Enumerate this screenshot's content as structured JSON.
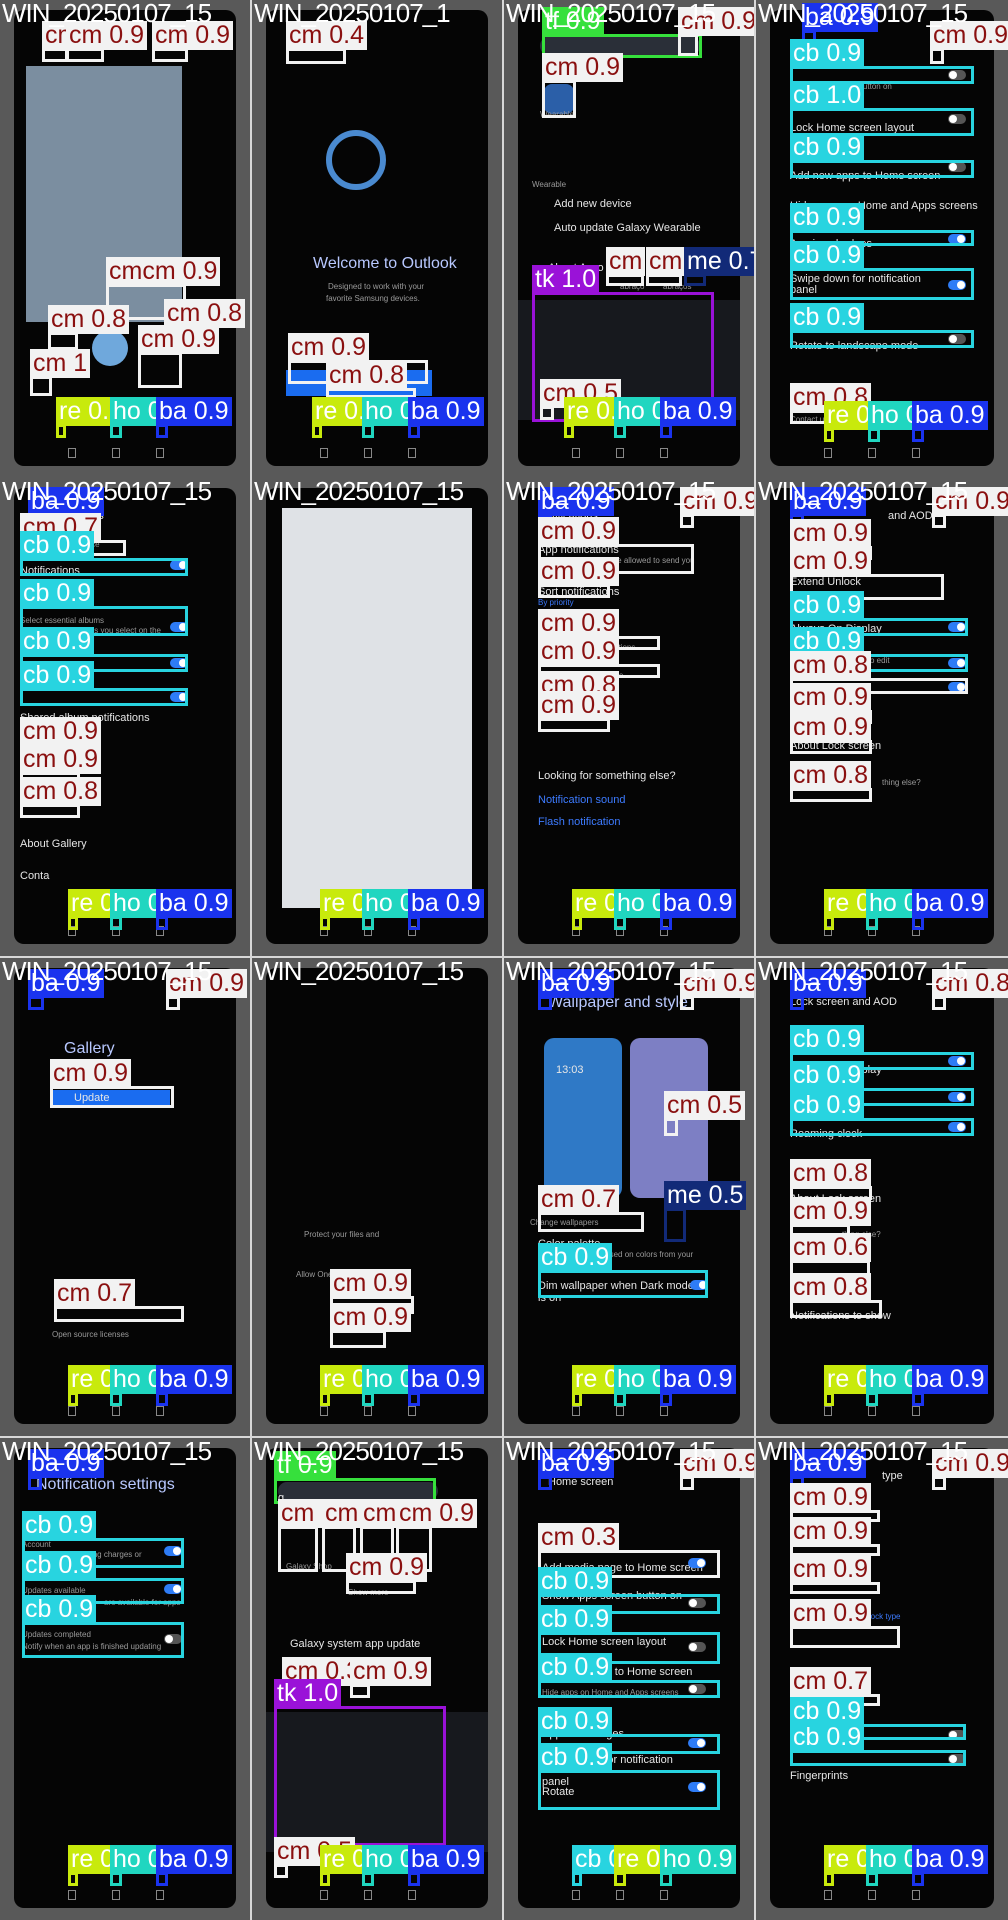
{
  "palette": {
    "re": "#c8ea0c",
    "cb": "#28d4e0",
    "ba": "#1a33ee",
    "cm": "#f2f2f2",
    "tf": "#36e03c",
    "tk": "#9a12d8",
    "me": "#122a78",
    "ho": "#20d6c0"
  },
  "tiles": [
    {
      "file": "WIN_20250107_15",
      "texts": []
    },
    {
      "file": "WIN_20250107_1",
      "texts": [
        {
          "k": "welcome_title",
          "v": "Welcome to Outlook"
        },
        {
          "k": "welcome_sub1",
          "v": "Designed to work with your"
        },
        {
          "k": "welcome_sub2",
          "v": "favorite Samsung devices."
        }
      ]
    },
    {
      "file": "WIN_20250107_15",
      "texts": [
        {
          "k": "search_text",
          "v": "ab"
        },
        {
          "k": "app_name",
          "v": "Wearable"
        },
        {
          "k": "section",
          "v": "Wearable"
        },
        {
          "k": "item1",
          "v": "Add new device"
        },
        {
          "k": "item2",
          "v": "Auto update Galaxy Wearable"
        },
        {
          "k": "item3",
          "v": "About Acco"
        },
        {
          "k": "sugg1",
          "v": "abraço"
        },
        {
          "k": "sugg2",
          "v": "abraços"
        }
      ]
    },
    {
      "file": "WIN_20250107_15",
      "texts": [
        {
          "k": "r1",
          "v": "Show Apps screen button on"
        },
        {
          "k": "r2",
          "v": "Lock Home screen layout"
        },
        {
          "k": "r3",
          "v": "Add new apps to Home screen"
        },
        {
          "k": "section",
          "v": "Hide apps on Home and Apps screens"
        },
        {
          "k": "r4",
          "v": "App icon badges"
        },
        {
          "k": "r5",
          "v": "Swipe down for notification"
        },
        {
          "k": "r5b",
          "v": "panel"
        },
        {
          "k": "r6",
          "v": "Rotate to landscape mode"
        },
        {
          "k": "r7",
          "v": "Contact us"
        }
      ]
    },
    {
      "file": "WIN_20250107_15",
      "texts": [
        {
          "k": "title",
          "v": "ngs"
        },
        {
          "k": "r0",
          "v": "Customization Service"
        },
        {
          "k": "r1",
          "v": "Notifications"
        },
        {
          "k": "r2",
          "v": "Select essential albums"
        },
        {
          "k": "r2s",
          "v": "Show only the albums you select on the"
        },
        {
          "k": "r3",
          "v": "Merge albums"
        },
        {
          "k": "r4",
          "v": "Shared album notifications"
        },
        {
          "k": "r5",
          "v": "Permissions"
        },
        {
          "k": "r6",
          "v": "About Gallery"
        },
        {
          "k": "r7",
          "v": "Conta"
        }
      ]
    },
    {
      "file": "WIN_20250107_15",
      "texts": []
    },
    {
      "file": "WIN_20250107_15",
      "texts": [
        {
          "k": "title",
          "v": "Notifications"
        },
        {
          "k": "r1",
          "v": "App notifications"
        },
        {
          "k": "r1s",
          "v": "Choose which apps are allowed to send you"
        },
        {
          "k": "r2",
          "v": "Sort notifications"
        },
        {
          "k": "r2s",
          "v": "By priority"
        },
        {
          "k": "r3",
          "v": "ations"
        },
        {
          "k": "r4",
          "v": "Notification pop-up style"
        },
        {
          "k": "r5",
          "v": "Advanced settings"
        },
        {
          "k": "r6",
          "v": "Looking for something else?"
        },
        {
          "k": "r7",
          "v": "Notification sound"
        },
        {
          "k": "r8",
          "v": "Flash notification"
        }
      ]
    },
    {
      "file": "WIN_20250107_15",
      "texts": [
        {
          "k": "title",
          "v": "and AOD"
        },
        {
          "k": "r1",
          "v": "Screen lock type"
        },
        {
          "k": "r2",
          "v": "Extend Unlock"
        },
        {
          "k": "r3",
          "v": "Always On Display"
        },
        {
          "k": "r4",
          "v": "o edit"
        },
        {
          "k": "r5",
          "v": "Widgets"
        },
        {
          "k": "r6",
          "v": "About Lock screen"
        },
        {
          "k": "r7",
          "v": "thing else?"
        }
      ]
    },
    {
      "file": "WIN_20250107_15",
      "texts": [
        {
          "k": "title",
          "v": "Gallery"
        },
        {
          "k": "btn",
          "v": "Update"
        },
        {
          "k": "r1",
          "v": "Open source licenses"
        }
      ]
    },
    {
      "file": "WIN_20250107_15",
      "texts": [
        {
          "k": "r1",
          "v": "Protect your files and"
        },
        {
          "k": "r2",
          "v": "Allow OneDrive"
        },
        {
          "k": "r3",
          "v": "Don't allow"
        }
      ]
    },
    {
      "file": "WIN_20250107_15",
      "texts": [
        {
          "k": "title",
          "v": "Wallpaper and style"
        },
        {
          "k": "time",
          "v": "13:03"
        },
        {
          "k": "r1",
          "v": "Change wallpapers"
        },
        {
          "k": "r2",
          "v": "Color palette"
        },
        {
          "k": "r2s",
          "v": "Choose a palette based on colors from your"
        },
        {
          "k": "r3",
          "v": "Dim wallpaper when Dark mode"
        },
        {
          "k": "r3b",
          "v": "is on"
        }
      ]
    },
    {
      "file": "WIN_20250107_15",
      "texts": [
        {
          "k": "title",
          "v": "Lock screen and AOD"
        },
        {
          "k": "r1",
          "v": "Always On Display"
        },
        {
          "k": "r2",
          "v": "o edit"
        },
        {
          "k": "r3",
          "v": "Roaming clock"
        },
        {
          "k": "r4",
          "v": "Widgets"
        },
        {
          "k": "r5",
          "v": "About Lock screen"
        },
        {
          "k": "r6",
          "v": "thing else?"
        },
        {
          "k": "r7",
          "v": "Fingerprints"
        },
        {
          "k": "r8",
          "v": "Notifications to show"
        }
      ]
    },
    {
      "file": "WIN_20250107_15",
      "texts": [
        {
          "k": "title",
          "v": "Notification settings"
        },
        {
          "k": "r1",
          "v": "Account"
        },
        {
          "k": "r1s",
          "v": "Notify about upcoming charges or"
        },
        {
          "k": "r2",
          "v": "Updates available"
        },
        {
          "k": "r2s",
          "v": "are available for apps"
        },
        {
          "k": "r3",
          "v": "Updates completed"
        },
        {
          "k": "r3s",
          "v": "Notify when an app is finished updating"
        }
      ]
    },
    {
      "file": "WIN_20250107_15",
      "texts": [
        {
          "k": "search_text",
          "v": "g"
        },
        {
          "k": "app1",
          "v": "Galaxy Shop"
        },
        {
          "k": "more",
          "v": "Show more"
        },
        {
          "k": "s1",
          "v": "Galaxy system app update"
        },
        {
          "k": "s2",
          "v": "Galaxy Wearable"
        }
      ]
    },
    {
      "file": "WIN_20250107_15",
      "texts": [
        {
          "k": "title",
          "v": "Home screen"
        },
        {
          "k": "r1",
          "v": "Add media page to Home screen"
        },
        {
          "k": "r2",
          "v": "Show Apps screen button on"
        },
        {
          "k": "r3",
          "v": "Lock Home screen layout"
        },
        {
          "k": "r4",
          "v": "Add new apps to Home screen"
        },
        {
          "k": "section",
          "v": "Hide apps on Home and Apps screens"
        },
        {
          "k": "r5",
          "v": "App icon badges"
        },
        {
          "k": "r6",
          "v": "Swipe down for notification"
        },
        {
          "k": "r6b",
          "v": "panel"
        },
        {
          "k": "r7",
          "v": "Rotate"
        }
      ]
    },
    {
      "file": "WIN_20250107_15",
      "texts": [
        {
          "k": "title",
          "v": "type"
        },
        {
          "k": "r1",
          "v": "PIN"
        },
        {
          "k": "r2",
          "v": "Password"
        },
        {
          "k": "r3",
          "v": "Pattern"
        },
        {
          "k": "r4",
          "v": "Swipe"
        },
        {
          "k": "r4s",
          "v": "No security."
        },
        {
          "k": "r4l",
          "v": "Current lock type"
        },
        {
          "k": "r5",
          "v": "Fingerprints"
        }
      ]
    }
  ],
  "detections": [
    [
      {
        "c": "cm",
        "s": "cm 0.9"
      },
      {
        "c": "cm",
        "s": "cm 0.9"
      },
      {
        "c": "cm",
        "s": "cm 0.9"
      },
      {
        "c": "cm",
        "s": "cmcm 0.9"
      },
      {
        "c": "cm",
        "s": "cm 0.8"
      },
      {
        "c": "cm",
        "s": "cm 0.8"
      },
      {
        "c": "cm",
        "s": "cm 1"
      },
      {
        "c": "cm",
        "s": "cm 0.9"
      },
      {
        "c": "re",
        "s": "re 0.9"
      },
      {
        "c": "ho",
        "s": "ho 0.9"
      },
      {
        "c": "ba",
        "s": "ba 0.9"
      }
    ],
    [
      {
        "c": "cm",
        "s": "cm 0.4"
      },
      {
        "c": "cm",
        "s": "cm 0.9"
      },
      {
        "c": "cm",
        "s": "cm 0.8"
      },
      {
        "c": "re",
        "s": "re 0.9"
      },
      {
        "c": "ho",
        "s": "ho 0.9"
      },
      {
        "c": "ba",
        "s": "ba 0.9"
      }
    ],
    [
      {
        "c": "tf",
        "s": "tf 0.9"
      },
      {
        "c": "cm",
        "s": "cm 0.9"
      },
      {
        "c": "cm",
        "s": "cm 0.9"
      },
      {
        "c": "cm",
        "s": "cm"
      },
      {
        "c": "cm",
        "s": "cm"
      },
      {
        "c": "me",
        "s": "me 0.7"
      },
      {
        "c": "tk",
        "s": "tk 1.0"
      },
      {
        "c": "cm",
        "s": "cm 0.5"
      },
      {
        "c": "re",
        "s": "re 0.9"
      },
      {
        "c": "ho",
        "s": "ho 0.9"
      },
      {
        "c": "ba",
        "s": "ba 0.9"
      }
    ],
    [
      {
        "c": "ba",
        "s": "ba 0.9"
      },
      {
        "c": "cm",
        "s": "cm 0.9"
      },
      {
        "c": "cb",
        "s": "cb 0.9"
      },
      {
        "c": "cb",
        "s": "cb 1.0"
      },
      {
        "c": "cb",
        "s": "cb 0.9"
      },
      {
        "c": "cb",
        "s": "cb 0.9"
      },
      {
        "c": "cb",
        "s": "cb 0.9"
      },
      {
        "c": "cb",
        "s": "cb 0.9"
      },
      {
        "c": "cm",
        "s": "cm 0.8"
      },
      {
        "c": "re",
        "s": "re 0.9"
      },
      {
        "c": "ho",
        "s": "ho 0.9"
      },
      {
        "c": "ba",
        "s": "ba 0.9"
      }
    ],
    [
      {
        "c": "ba",
        "s": "ba 0.9"
      },
      {
        "c": "cm",
        "s": "cm 0.7"
      },
      {
        "c": "cb",
        "s": "cb 0.9"
      },
      {
        "c": "cb",
        "s": "cb 0.9"
      },
      {
        "c": "cb",
        "s": "cb 0.9"
      },
      {
        "c": "cb",
        "s": "cb 0.9"
      },
      {
        "c": "cm",
        "s": "cm 0.9"
      },
      {
        "c": "cm",
        "s": "cm 0.9"
      },
      {
        "c": "cm",
        "s": "cm 0.8"
      },
      {
        "c": "re",
        "s": "re 0.9"
      },
      {
        "c": "ho",
        "s": "ho 0.9"
      },
      {
        "c": "ba",
        "s": "ba 0.9"
      }
    ],
    [
      {
        "c": "re",
        "s": "re 0.8"
      },
      {
        "c": "ho",
        "s": "ho 0.9"
      },
      {
        "c": "ba",
        "s": "ba 0.9"
      }
    ],
    [
      {
        "c": "ba",
        "s": "ba 0.9"
      },
      {
        "c": "cm",
        "s": "cm 0.9"
      },
      {
        "c": "cm",
        "s": "cm 0.9"
      },
      {
        "c": "cm",
        "s": "cm 0.9"
      },
      {
        "c": "cm",
        "s": "cm 0.9"
      },
      {
        "c": "cm",
        "s": "cm 0.9"
      },
      {
        "c": "cm",
        "s": "cm 0.8"
      },
      {
        "c": "cm",
        "s": "cm 0.9"
      },
      {
        "c": "re",
        "s": "re 0.9"
      },
      {
        "c": "ho",
        "s": "ho 0.9"
      },
      {
        "c": "ba",
        "s": "ba 0.9"
      }
    ],
    [
      {
        "c": "ba",
        "s": "ba 0.9"
      },
      {
        "c": "cm",
        "s": "cm 0.9"
      },
      {
        "c": "cm",
        "s": "cm 0.9"
      },
      {
        "c": "cm",
        "s": "cm 0.9"
      },
      {
        "c": "cb",
        "s": "cb 0.9"
      },
      {
        "c": "cb",
        "s": "cb 0.9"
      },
      {
        "c": "cm",
        "s": "cm 0.8"
      },
      {
        "c": "cm",
        "s": "cm 0.9"
      },
      {
        "c": "cm",
        "s": "cm 0.9"
      },
      {
        "c": "cm",
        "s": "cm 0.8"
      },
      {
        "c": "re",
        "s": "re 0.9"
      },
      {
        "c": "ho",
        "s": "ho 0.9"
      },
      {
        "c": "ba",
        "s": "ba 0.9"
      }
    ],
    [
      {
        "c": "ba",
        "s": "ba 0.9"
      },
      {
        "c": "cm",
        "s": "cm 0.9"
      },
      {
        "c": "cm",
        "s": "cm 0.9"
      },
      {
        "c": "cm",
        "s": "cm 0.7"
      },
      {
        "c": "re",
        "s": "re 0.9"
      },
      {
        "c": "ho",
        "s": "ho 0.9"
      },
      {
        "c": "ba",
        "s": "ba 0.9"
      }
    ],
    [
      {
        "c": "cm",
        "s": "cm 0.9"
      },
      {
        "c": "cm",
        "s": "cm 0.9"
      },
      {
        "c": "re",
        "s": "re 0.9"
      },
      {
        "c": "ho",
        "s": "ho 0.9"
      },
      {
        "c": "ba",
        "s": "ba 0.9"
      }
    ],
    [
      {
        "c": "ba",
        "s": "ba 0.9"
      },
      {
        "c": "cm",
        "s": "cm 0.9"
      },
      {
        "c": "cm",
        "s": "cm 0.5"
      },
      {
        "c": "cm",
        "s": "cm 0.7"
      },
      {
        "c": "me",
        "s": "me 0.5"
      },
      {
        "c": "cb",
        "s": "cb 0.9"
      },
      {
        "c": "re",
        "s": "re 0.9"
      },
      {
        "c": "ho",
        "s": "ho 0.9"
      },
      {
        "c": "ba",
        "s": "ba 0.9"
      }
    ],
    [
      {
        "c": "ba",
        "s": "ba 0.9"
      },
      {
        "c": "cm",
        "s": "cm 0.8"
      },
      {
        "c": "cb",
        "s": "cb 0.9"
      },
      {
        "c": "cb",
        "s": "cb 0.9"
      },
      {
        "c": "cb",
        "s": "cb 0.9"
      },
      {
        "c": "cm",
        "s": "cm 0.8"
      },
      {
        "c": "cm",
        "s": "cm 0.9"
      },
      {
        "c": "cm",
        "s": "cm 0.6"
      },
      {
        "c": "cm",
        "s": "cm 0.8"
      },
      {
        "c": "re",
        "s": "re 0.9"
      },
      {
        "c": "ho",
        "s": "ho 0.9"
      },
      {
        "c": "ba",
        "s": "ba 0.9"
      }
    ],
    [
      {
        "c": "ba",
        "s": "ba 0.9"
      },
      {
        "c": "cb",
        "s": "cb 0.9"
      },
      {
        "c": "cb",
        "s": "cb 0.9"
      },
      {
        "c": "cb",
        "s": "cb 0.9"
      },
      {
        "c": "re",
        "s": "re 0.9"
      },
      {
        "c": "ho",
        "s": "ho 0.9"
      },
      {
        "c": "ba",
        "s": "ba 0.9"
      }
    ],
    [
      {
        "c": "tf",
        "s": "tf 0.9"
      },
      {
        "c": "cm",
        "s": "cm 0.9"
      },
      {
        "c": "cm",
        "s": "cm 0.9"
      },
      {
        "c": "cm",
        "s": "cm 0.9"
      },
      {
        "c": "cm",
        "s": "cm 0.9"
      },
      {
        "c": "cm",
        "s": "cm 0.9"
      },
      {
        "c": "cm",
        "s": "cm 0.3"
      },
      {
        "c": "cm",
        "s": "cm 0.9"
      },
      {
        "c": "tk",
        "s": "tk 1.0"
      },
      {
        "c": "cm",
        "s": "cm 0.5"
      },
      {
        "c": "re",
        "s": "re 0.9"
      },
      {
        "c": "ho",
        "s": "ho 0.9"
      },
      {
        "c": "ba",
        "s": "ba 0.9"
      }
    ],
    [
      {
        "c": "ba",
        "s": "ba 0.9"
      },
      {
        "c": "cm",
        "s": "cm 0.9"
      },
      {
        "c": "cm",
        "s": "cm 0.3"
      },
      {
        "c": "cb",
        "s": "cb 0.9"
      },
      {
        "c": "cb",
        "s": "cb 0.9"
      },
      {
        "c": "cb",
        "s": "cb 0.9"
      },
      {
        "c": "cb",
        "s": "cb 0.9"
      },
      {
        "c": "cb",
        "s": "cb 0.9"
      },
      {
        "c": "cb",
        "s": "cb 0.9"
      },
      {
        "c": "re",
        "s": "re 0.9"
      },
      {
        "c": "ho",
        "s": "ho 0.9"
      },
      {
        "c": "ba",
        "s": "ba 0.9"
      }
    ],
    [
      {
        "c": "ba",
        "s": "ba 0.9"
      },
      {
        "c": "cm",
        "s": "cm 0.9"
      },
      {
        "c": "cm",
        "s": "cm 0.9"
      },
      {
        "c": "cm",
        "s": "cm 0.9"
      },
      {
        "c": "cm",
        "s": "cm 0.9"
      },
      {
        "c": "cm",
        "s": "cm 0.9"
      },
      {
        "c": "cm",
        "s": "cm 0.7"
      },
      {
        "c": "cb",
        "s": "cb 0.9"
      },
      {
        "c": "cb",
        "s": "cb 0.9"
      },
      {
        "c": "re",
        "s": "re 0.9"
      },
      {
        "c": "ho",
        "s": "ho 0.9"
      },
      {
        "c": "ba",
        "s": "ba 0.9"
      }
    ]
  ]
}
